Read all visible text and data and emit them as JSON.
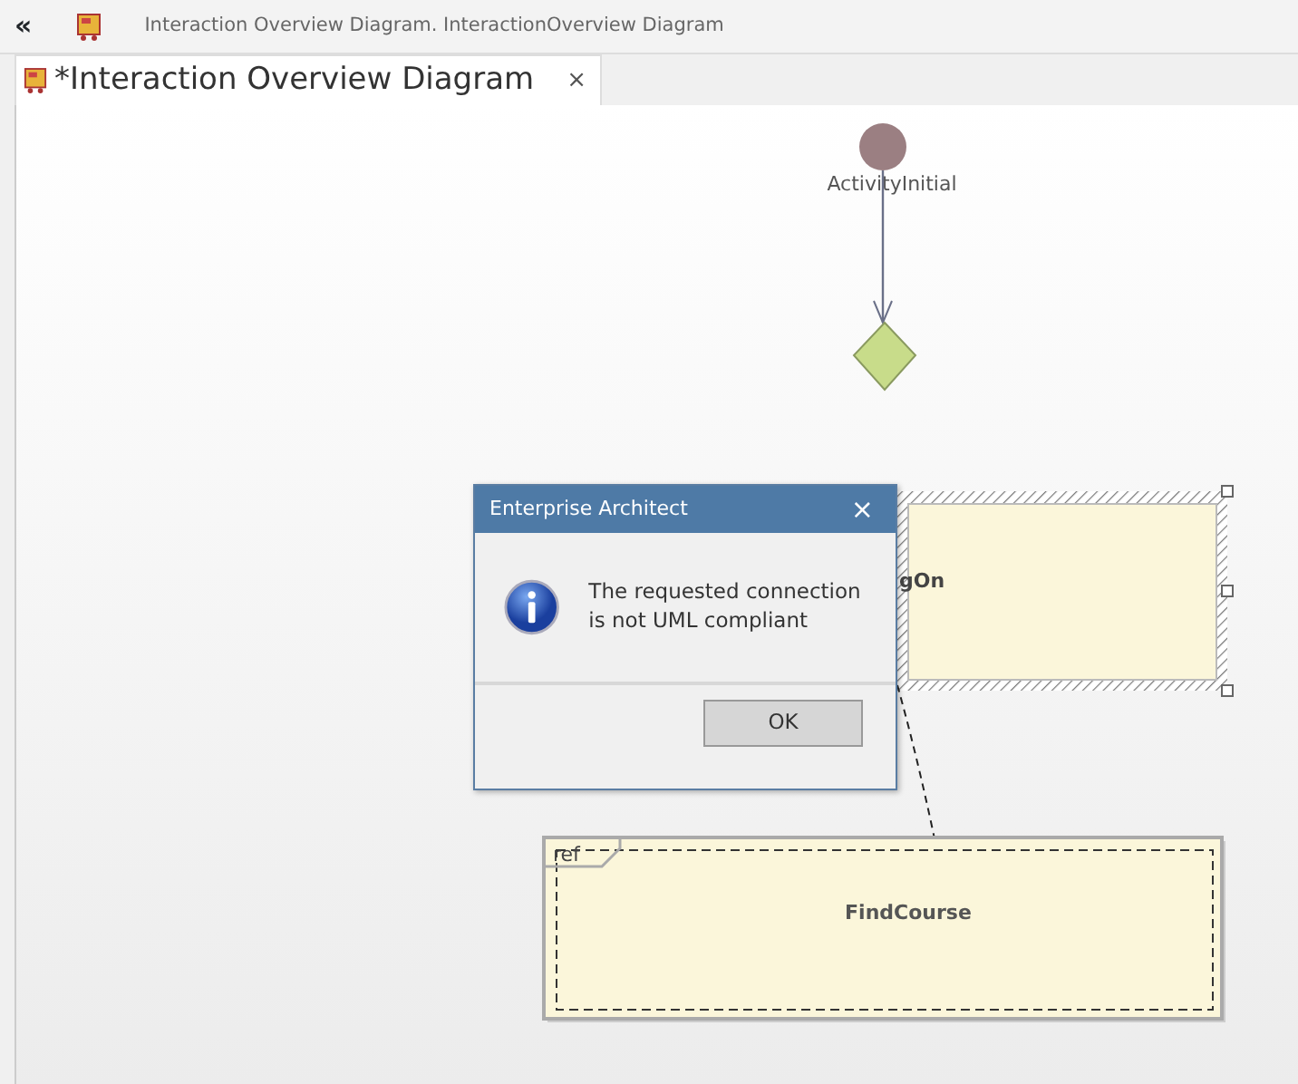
{
  "toolbar": {
    "collapse": "«",
    "breadcrumb": "Interaction Overview Diagram.  InteractionOverview Diagram"
  },
  "tabs": [
    {
      "label": "*Interaction Overview Diagram",
      "close": "×",
      "selected": true
    }
  ],
  "diagram": {
    "nodes": [
      {
        "kind": "initial",
        "label": "ActivityInitial"
      },
      {
        "kind": "decision"
      },
      {
        "kind": "activity",
        "label": "gOn",
        "selected": true
      },
      {
        "kind": "ref",
        "tag": "ref",
        "label": "FindCourse",
        "selected": false
      }
    ]
  },
  "dialog": {
    "title": "Enterprise Architect",
    "close": "×",
    "message": "The requested connection is not UML compliant",
    "buttons": [
      "OK"
    ]
  }
}
